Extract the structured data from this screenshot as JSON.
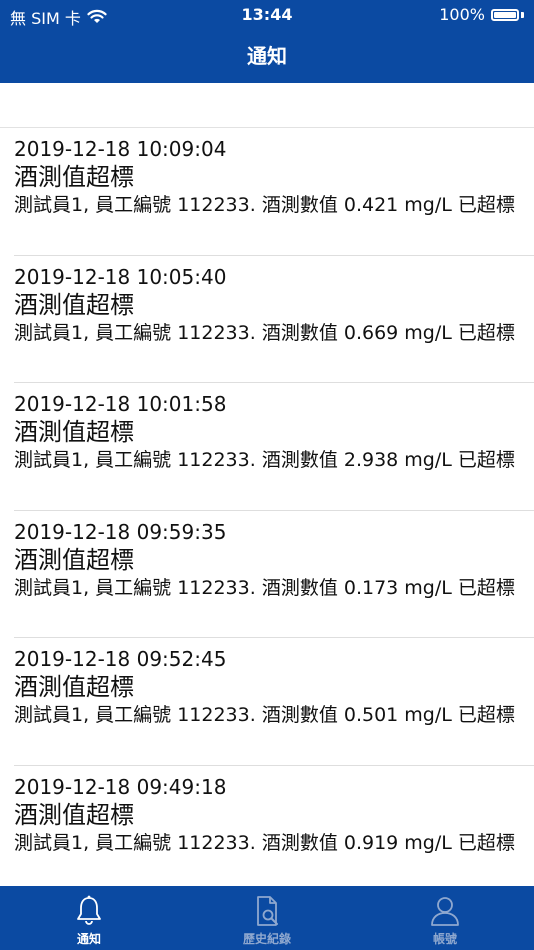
{
  "status_bar": {
    "carrier": "無 SIM 卡",
    "time": "13:44",
    "battery": "100%",
    "battery_level": 1.0
  },
  "header": {
    "title": "通知"
  },
  "notifications": [
    {
      "time": "2019-12-18 10:09:04",
      "title": "酒測值超標",
      "body": "測試員1, 員工編號 112233. 酒測數值 0.421 mg/L 已超標"
    },
    {
      "time": "2019-12-18 10:05:40",
      "title": "酒測值超標",
      "body": "測試員1, 員工編號 112233. 酒測數值 0.669 mg/L 已超標"
    },
    {
      "time": "2019-12-18 10:01:58",
      "title": "酒測值超標",
      "body": "測試員1, 員工編號 112233. 酒測數值 2.938 mg/L 已超標"
    },
    {
      "time": "2019-12-18 09:59:35",
      "title": "酒測值超標",
      "body": "測試員1, 員工編號 112233. 酒測數值 0.173 mg/L 已超標"
    },
    {
      "time": "2019-12-18 09:52:45",
      "title": "酒測值超標",
      "body": "測試員1, 員工編號 112233. 酒測數值 0.501 mg/L 已超標"
    },
    {
      "time": "2019-12-18 09:49:18",
      "title": "酒測值超標",
      "body": "測試員1, 員工編號 112233. 酒測數值 0.919 mg/L 已超標"
    }
  ],
  "tab_bar": {
    "tabs": [
      {
        "label": "通知",
        "icon": "bell-icon",
        "active": true
      },
      {
        "label": "歷史紀錄",
        "icon": "document-search-icon",
        "active": false
      },
      {
        "label": "帳號",
        "icon": "person-icon",
        "active": false
      }
    ]
  },
  "colors": {
    "brand_blue": "#0b4aa2",
    "active_tab": "#ffffff",
    "inactive_tab": "#8fa8cf"
  }
}
